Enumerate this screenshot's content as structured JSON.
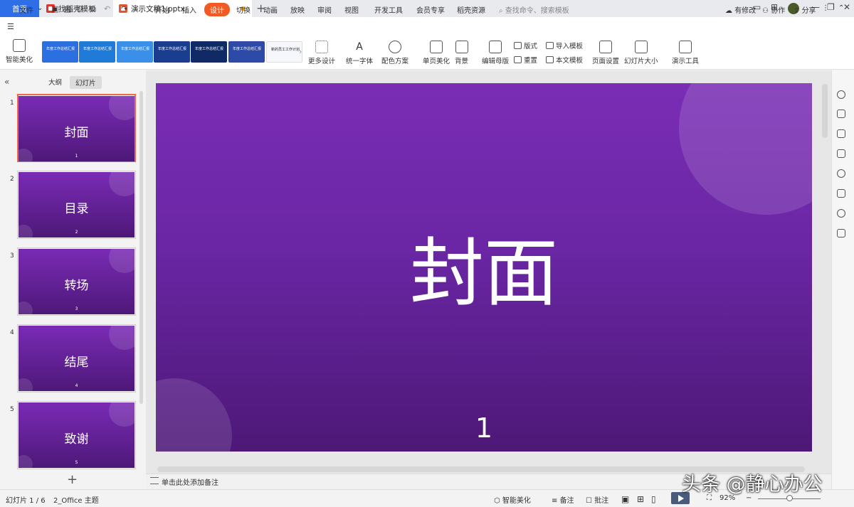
{
  "titlebar": {
    "tabs": [
      {
        "label": "首页"
      },
      {
        "label": "找稻壳模板"
      },
      {
        "label": "演示文稿1.pptx"
      }
    ],
    "new_tab": "+",
    "window_icons": [
      "layout-icon",
      "avatar",
      "minimize-icon",
      "restore-icon",
      "close-icon"
    ]
  },
  "menubar": {
    "file": "文件",
    "items": [
      "开始",
      "插入",
      "设计",
      "切换",
      "动画",
      "放映",
      "审阅",
      "视图",
      "开发工具",
      "会员专享",
      "稻壳资源"
    ],
    "active": "设计",
    "search_placeholder": "查找命令、搜索模板",
    "right": [
      "有修改",
      "协作",
      "分享"
    ]
  },
  "ribbon": {
    "smart_beautify": "智能美化",
    "templates": [
      {
        "text": "年度工作总结汇报",
        "color": "#2b6fe0"
      },
      {
        "text": "年度工作总结汇报",
        "color": "#1f7ad8"
      },
      {
        "text": "年度工作总结汇报",
        "color": "#3a8fe8"
      },
      {
        "text": "年度工作总结汇报",
        "color": "#1a3d8f"
      },
      {
        "text": "年度工作总结汇报",
        "color": "#102a66"
      },
      {
        "text": "年度工作总结汇报",
        "color": "#2d4aa6"
      },
      {
        "text": "新的员工工作计划",
        "color": "#f5f7fb"
      }
    ],
    "more_design": "更多设计",
    "unify_font": "统一字体",
    "color_scheme": "配色方案",
    "single_page": "单页美化",
    "background": "背景",
    "edit_master": "编辑母版",
    "layout": "版式",
    "reset": "重置",
    "import_template": "导入模板",
    "text_template": "本文模板",
    "page_setup": "页面设置",
    "slide_size": "幻灯片大小",
    "present_tools": "演示工具"
  },
  "leftpanel": {
    "outline_tab": "大纲",
    "slides_tab": "幻灯片",
    "slides": [
      {
        "num": "1",
        "title": "封面",
        "page": "1"
      },
      {
        "num": "2",
        "title": "目录",
        "page": "2"
      },
      {
        "num": "3",
        "title": "转场",
        "page": "3"
      },
      {
        "num": "4",
        "title": "结尾",
        "page": "4"
      },
      {
        "num": "5",
        "title": "致谢",
        "page": "5"
      }
    ],
    "add": "+"
  },
  "main_slide": {
    "title": "封面",
    "number": "1"
  },
  "notes_placeholder": "单击此处添加备注",
  "statusbar": {
    "slide_info": "幻灯片 1 / 6",
    "theme": "2_Office 主题",
    "smart": "智能美化",
    "notes": "备注",
    "comments": "批注",
    "zoom": "92%"
  },
  "watermark": "头条 @静心办公"
}
